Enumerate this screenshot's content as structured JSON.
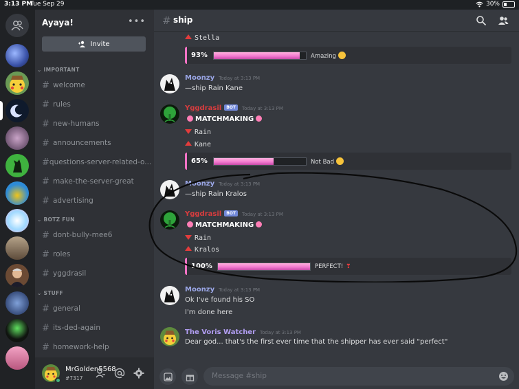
{
  "statusbar": {
    "time": "3:13 PM",
    "date": "Tue Sep 29",
    "battery": "30%",
    "battery_level": 0.3
  },
  "servers": [
    {
      "name": "home-icon"
    },
    {
      "name": "server-1"
    },
    {
      "name": "server-2"
    },
    {
      "name": "server-3"
    },
    {
      "name": "server-4"
    },
    {
      "name": "server-5"
    },
    {
      "name": "server-6"
    },
    {
      "name": "server-7"
    },
    {
      "name": "server-8"
    },
    {
      "name": "server-9"
    },
    {
      "name": "server-10"
    },
    {
      "name": "server-11"
    },
    {
      "name": "server-12"
    }
  ],
  "guild": {
    "name": "Ayaya!",
    "invite_label": "Invite"
  },
  "categories": {
    "important": "IMPORTANT",
    "botz": "BOTZ FUN",
    "stuff": "STUFF"
  },
  "channels": {
    "important": [
      "welcome",
      "rules",
      "new-humans",
      "announcements",
      "questions-server-related-o...",
      "make-the-server-great",
      "advertising"
    ],
    "botz": [
      "dont-bully-mee6",
      "roles",
      "yggdrasil"
    ],
    "stuff": [
      "general",
      "its-ded-again",
      "homework-help"
    ]
  },
  "user": {
    "name": "MrGolden5568",
    "discriminator": "#7317"
  },
  "header": {
    "channel": "ship"
  },
  "messages": {
    "top_stella": "Stella",
    "embed1": {
      "percent": "93%",
      "value": 0.93,
      "verdict": "Amazing"
    },
    "m1": {
      "author": "Moonzy",
      "time": "Today at 3:13 PM",
      "text": "—ship Rain Kane"
    },
    "m2": {
      "author": "Yggdrasil",
      "badge": "BOT",
      "time": "Today at 3:13 PM",
      "title": "MATCHMAKING",
      "name1": "Rain",
      "name2": "Kane"
    },
    "embed2": {
      "percent": "65%",
      "value": 0.65,
      "verdict": "Not Bad"
    },
    "m3": {
      "author": "Moonzy",
      "time": "Today at 3:13 PM",
      "text": "—ship Rain Kralos"
    },
    "m4": {
      "author": "Yggdrasil",
      "badge": "BOT",
      "time": "Today at 3:13 PM",
      "title": "MATCHMAKING",
      "name1": "Rain",
      "name2": "Kralos"
    },
    "embed3": {
      "percent": "100%",
      "value": 1.0,
      "verdict": "PERFECT!"
    },
    "m5": {
      "author": "Moonzy",
      "time": "Today at 3:13 PM",
      "line1": "Ok I've found his SO",
      "line2": "I'm done here"
    },
    "m6": {
      "author": "The Voris Watcher",
      "time": "Today at 3:13 PM",
      "text": "Dear god... that's the first ever time that the shipper has ever said \"perfect\""
    }
  },
  "composer": {
    "placeholder": "Message #ship"
  },
  "colors": {
    "moonzy": "#9aa6e6",
    "yggdrasil": "#d83c3e",
    "voris": "#b29ef3",
    "embed_accent": "#ff73c6"
  }
}
